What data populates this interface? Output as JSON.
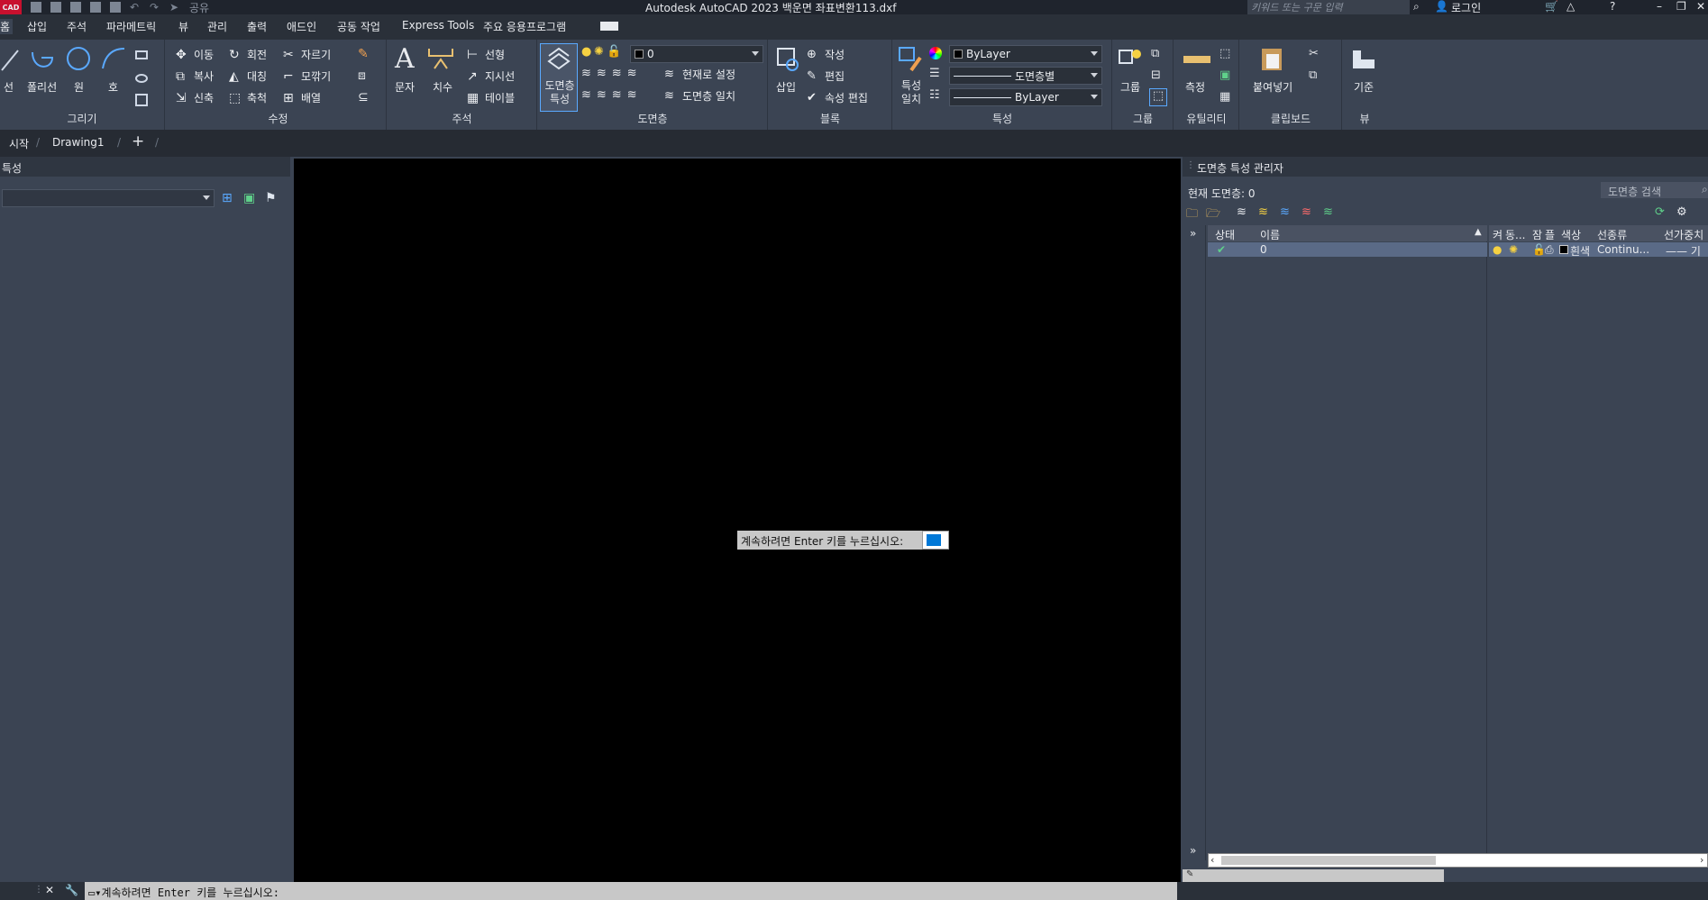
{
  "titlebar": {
    "logo": "CAD",
    "share": "공유",
    "title": "Autodesk AutoCAD 2023   백운면 좌표변환113.dxf",
    "search_placeholder": "키워드 또는 구문 입력",
    "login": "로그인"
  },
  "tabs": [
    "홈",
    "삽입",
    "주석",
    "파라메트릭",
    "뷰",
    "관리",
    "출력",
    "애드인",
    "공동 작업",
    "Express Tools",
    "주요 응용프로그램"
  ],
  "ribbon": {
    "draw": {
      "label": "그리기",
      "line": "선",
      "polyline": "폴리선",
      "circle": "원",
      "arc": "호"
    },
    "modify": {
      "label": "수정",
      "move": "이동",
      "rotate": "회전",
      "trim": "자르기",
      "copy": "복사",
      "mirror": "대칭",
      "fillet": "모깎기",
      "stretch": "신축",
      "scale": "축척",
      "array": "배열"
    },
    "annotation": {
      "label": "주석",
      "text": "문자",
      "dimension": "치수",
      "linear": "선형",
      "leader": "지시선",
      "table": "테이블"
    },
    "layers": {
      "label": "도면층",
      "props": "도면층 특성",
      "current_layer": "0",
      "make_current": "현재로 설정",
      "match_layer": "도면층 일치"
    },
    "block": {
      "label": "블록",
      "insert": "삽입",
      "create": "작성",
      "edit": "편집",
      "edit_attr": "속성 편집"
    },
    "properties": {
      "label": "특성",
      "match": "특성 일치",
      "color": "ByLayer",
      "linetype": "도면층별",
      "lineweight": "ByLayer"
    },
    "groups": {
      "label": "그룹",
      "group": "그룹"
    },
    "utilities": {
      "label": "유틸리티",
      "measure": "측정"
    },
    "clipboard": {
      "label": "클립보드",
      "paste": "붙여넣기"
    },
    "view": {
      "label": "뷰",
      "base": "기준"
    }
  },
  "doctabs": {
    "start": "시작",
    "drawing": "Drawing1"
  },
  "leftpanel": {
    "title": "특성"
  },
  "canvas": {
    "prompt": "계속하려면 Enter 키를 누르십시오:"
  },
  "layer_manager": {
    "title": "도면층 특성 관리자",
    "current": "현재 도면층: 0",
    "search_placeholder": "도면층 검색",
    "left_headers": {
      "status": "상태",
      "name": "이름"
    },
    "right_headers": [
      "켜",
      "동...",
      "잠",
      "플",
      "색상",
      "선종류",
      "선가중치"
    ],
    "row": {
      "name": "0",
      "color": "흰색",
      "linetype": "Continu...",
      "lineweight": "—— 기"
    }
  },
  "cmdline": {
    "text": "계속하려면 Enter 키를 누르십시오:"
  },
  "colors": {
    "accent": "#0078d7",
    "selected_row": "#5a6a86"
  }
}
